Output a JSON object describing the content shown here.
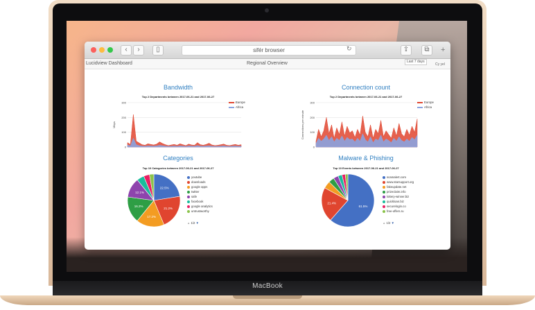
{
  "device": {
    "brand_label": "MacBook"
  },
  "browser": {
    "url": "sifér browser",
    "tab_left": "Lucidview Dashboard",
    "tab_center": "Regional Overview",
    "select_value": "Last 7 days",
    "select_right": "Cy yel"
  },
  "panels": {
    "bandwidth": {
      "title": "Bandwidth",
      "subtitle": "Top 2 Departments between 2017-06-21 and 2017-06-27",
      "ylabel": "Mbps",
      "legend": [
        "Europe",
        "Africa"
      ]
    },
    "connections": {
      "title": "Connection count",
      "subtitle": "Top 2 Departments between 2017-06-21 and 2017-06-27",
      "ylabel": "Connections per minute",
      "legend": [
        "Europe",
        "Africa"
      ]
    },
    "categories": {
      "title": "Categories",
      "subtitle": "Top 10 Categories between 2017-06-21 and 2017-06-27",
      "legend": [
        "youtube",
        "downloads",
        "google apps",
        "twitter",
        "safe",
        "facebook",
        "google analytics",
        "untrustworthy"
      ],
      "pager": "1/2"
    },
    "malware": {
      "title": "Malware & Phishing",
      "subtitle": "Top 10 Events between 2017-06-21 and 2017-06-27",
      "legend": [
        "scamalert.com",
        "www.starsupport.org",
        "fakeupdate.net",
        "prizeclaim.info",
        "lottery-winner.biz",
        "quickloan.biz",
        "securelogin.co",
        "free-offers.ru"
      ],
      "pager": "1/2"
    }
  },
  "chart_data": [
    {
      "type": "area",
      "title": "Bandwidth",
      "ylabel": "Mbps",
      "ylim": [
        0,
        300
      ],
      "yticks": [
        "0",
        "100",
        "200",
        "300"
      ],
      "series": [
        {
          "name": "Europe",
          "values": [
            30,
            18,
            220,
            40,
            28,
            16,
            12,
            22,
            18,
            14,
            20,
            35,
            24,
            16,
            10,
            14,
            18,
            12,
            22,
            16,
            10,
            20,
            14,
            12,
            30,
            16,
            12,
            18,
            26,
            14,
            10,
            12,
            16,
            20,
            12,
            10,
            14,
            18,
            12,
            16
          ]
        },
        {
          "name": "Africa",
          "values": [
            14,
            8,
            60,
            16,
            10,
            6,
            5,
            8,
            7,
            6,
            8,
            12,
            9,
            6,
            4,
            5,
            7,
            5,
            8,
            6,
            4,
            8,
            6,
            5,
            10,
            6,
            5,
            7,
            9,
            5,
            4,
            5,
            6,
            8,
            5,
            4,
            6,
            7,
            5,
            6
          ]
        }
      ]
    },
    {
      "type": "area",
      "title": "Connection count",
      "ylabel": "Connections per minute",
      "ylim": [
        0,
        300
      ],
      "yticks": [
        "0",
        "100",
        "200",
        "300"
      ],
      "series": [
        {
          "name": "Europe",
          "values": [
            40,
            120,
            70,
            110,
            200,
            90,
            150,
            60,
            130,
            85,
            170,
            75,
            140,
            95,
            110,
            65,
            120,
            80,
            210,
            100,
            70,
            150,
            60,
            120,
            90,
            180,
            70,
            110,
            85,
            60,
            130,
            75,
            160,
            90,
            70,
            120,
            80,
            140,
            100,
            190
          ]
        },
        {
          "name": "Africa",
          "values": [
            25,
            60,
            40,
            55,
            80,
            45,
            70,
            35,
            60,
            45,
            75,
            40,
            65,
            50,
            55,
            35,
            60,
            40,
            90,
            50,
            35,
            70,
            30,
            55,
            45,
            80,
            35,
            55,
            45,
            30,
            60,
            40,
            70,
            45,
            35,
            55,
            40,
            65,
            50,
            80
          ]
        }
      ]
    },
    {
      "type": "pie",
      "title": "Categories",
      "series": [
        {
          "name": "youtube",
          "value": 22.5,
          "label": "22.5%"
        },
        {
          "name": "downloads",
          "value": 21.2,
          "label": "21.2%"
        },
        {
          "name": "google apps",
          "value": 17.2,
          "label": "17.2%"
        },
        {
          "name": "twitter",
          "value": 16.2,
          "label": "16.2%"
        },
        {
          "name": "safe",
          "value": 12.1,
          "label": "12.1%"
        },
        {
          "name": "facebook",
          "value": 4.5,
          "label": ""
        },
        {
          "name": "google analytics",
          "value": 3.6,
          "label": ""
        },
        {
          "name": "untrustworthy",
          "value": 2.7,
          "label": ""
        }
      ]
    },
    {
      "type": "pie",
      "title": "Malware & Phishing",
      "series": [
        {
          "name": "scamalert.com",
          "value": 61.5,
          "label": "61.5%"
        },
        {
          "name": "www.starsupport.org",
          "value": 21.4,
          "label": "21.4%"
        },
        {
          "name": "fakeupdate.net",
          "value": 4.5,
          "label": ""
        },
        {
          "name": "prizeclaim.info",
          "value": 3.5,
          "label": ""
        },
        {
          "name": "lottery-winner.biz",
          "value": 3.0,
          "label": ""
        },
        {
          "name": "quickloan.biz",
          "value": 2.5,
          "label": ""
        },
        {
          "name": "securelogin.co",
          "value": 2.0,
          "label": ""
        },
        {
          "name": "free-offers.ru",
          "value": 1.6,
          "label": ""
        }
      ]
    }
  ],
  "colors": {
    "europe": "#e0452f",
    "africa": "#8aa3e0",
    "pie": [
      "#4470c4",
      "#e0452f",
      "#f39c22",
      "#2e9e45",
      "#8e44ad",
      "#1abc9c",
      "#e91e63",
      "#8bc34a"
    ]
  }
}
